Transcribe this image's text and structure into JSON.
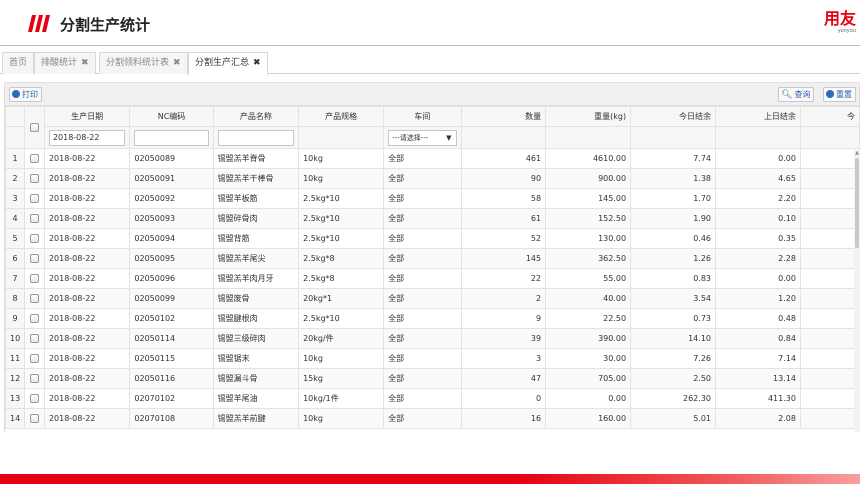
{
  "header": {
    "title": "分割生产统计",
    "logo_main": "用友",
    "logo_sub": "yonyou"
  },
  "tabs": [
    {
      "label": "首页",
      "closable": false
    },
    {
      "label": "排酸统计",
      "closable": true
    },
    {
      "label": "分割领料统计表",
      "closable": true
    },
    {
      "label": "分割生产汇总",
      "closable": true,
      "active": true
    }
  ],
  "toolbar": {
    "print": "打印",
    "query": "查询",
    "reset": "重置"
  },
  "columns": [
    "生产日期",
    "NC编码",
    "产品名称",
    "产品规格",
    "车间",
    "数量",
    "重量(kg)",
    "今日结余",
    "上日结余",
    "今"
  ],
  "filters": {
    "date": "2018-08-22",
    "nc_code": "",
    "product_name": "",
    "workshop": "---请选择---"
  },
  "rows": [
    {
      "n": "1",
      "date": "2018-08-22",
      "nc": "02050089",
      "name": "锡盟羔羊脊骨",
      "spec": "10kg",
      "ws": "全部",
      "qty": "461",
      "weight": "4610.00",
      "today": "7.74",
      "prev": "0.00"
    },
    {
      "n": "2",
      "date": "2018-08-22",
      "nc": "02050091",
      "name": "锡盟羔羊干棒骨",
      "spec": "10kg",
      "ws": "全部",
      "qty": "90",
      "weight": "900.00",
      "today": "1.38",
      "prev": "4.65"
    },
    {
      "n": "3",
      "date": "2018-08-22",
      "nc": "02050092",
      "name": "锡盟羊板筋",
      "spec": "2.5kg*10",
      "ws": "全部",
      "qty": "58",
      "weight": "145.00",
      "today": "1.70",
      "prev": "2.20"
    },
    {
      "n": "4",
      "date": "2018-08-22",
      "nc": "02050093",
      "name": "锡盟碎骨肉",
      "spec": "2.5kg*10",
      "ws": "全部",
      "qty": "61",
      "weight": "152.50",
      "today": "1.90",
      "prev": "0.10"
    },
    {
      "n": "5",
      "date": "2018-08-22",
      "nc": "02050094",
      "name": "锡盟背筋",
      "spec": "2.5kg*10",
      "ws": "全部",
      "qty": "52",
      "weight": "130.00",
      "today": "0.46",
      "prev": "0.35"
    },
    {
      "n": "6",
      "date": "2018-08-22",
      "nc": "02050095",
      "name": "锡盟羔羊尾尖",
      "spec": "2.5kg*8",
      "ws": "全部",
      "qty": "145",
      "weight": "362.50",
      "today": "1.26",
      "prev": "2.28"
    },
    {
      "n": "7",
      "date": "2018-08-22",
      "nc": "02050096",
      "name": "锡盟羔羊肉月牙",
      "spec": "2.5kg*8",
      "ws": "全部",
      "qty": "22",
      "weight": "55.00",
      "today": "0.83",
      "prev": "0.00"
    },
    {
      "n": "8",
      "date": "2018-08-22",
      "nc": "02050099",
      "name": "锡盟废骨",
      "spec": "20kg*1",
      "ws": "全部",
      "qty": "2",
      "weight": "40.00",
      "today": "3.54",
      "prev": "1.20"
    },
    {
      "n": "9",
      "date": "2018-08-22",
      "nc": "02050102",
      "name": "锡盟腱根肉",
      "spec": "2.5kg*10",
      "ws": "全部",
      "qty": "9",
      "weight": "22.50",
      "today": "0.73",
      "prev": "0.48"
    },
    {
      "n": "10",
      "date": "2018-08-22",
      "nc": "02050114",
      "name": "锡盟三级碎肉",
      "spec": "20kg/件",
      "ws": "全部",
      "qty": "39",
      "weight": "390.00",
      "today": "14.10",
      "prev": "0.84"
    },
    {
      "n": "11",
      "date": "2018-08-22",
      "nc": "02050115",
      "name": "锡盟锯末",
      "spec": "10kg",
      "ws": "全部",
      "qty": "3",
      "weight": "30.00",
      "today": "7.26",
      "prev": "7.14"
    },
    {
      "n": "12",
      "date": "2018-08-22",
      "nc": "02050116",
      "name": "锡盟漏斗骨",
      "spec": "15kg",
      "ws": "全部",
      "qty": "47",
      "weight": "705.00",
      "today": "2.50",
      "prev": "13.14"
    },
    {
      "n": "13",
      "date": "2018-08-22",
      "nc": "02070102",
      "name": "锡盟羊尾油",
      "spec": "10kg/1件",
      "ws": "全部",
      "qty": "0",
      "weight": "0.00",
      "today": "262.30",
      "prev": "411.30"
    },
    {
      "n": "14",
      "date": "2018-08-22",
      "nc": "02070108",
      "name": "锡盟羔羊前腱",
      "spec": "10kg",
      "ws": "全部",
      "qty": "16",
      "weight": "160.00",
      "today": "5.01",
      "prev": "2.08"
    }
  ],
  "colors": {
    "brand_red": "#e60012",
    "accent_blue": "#2a5ea8"
  }
}
